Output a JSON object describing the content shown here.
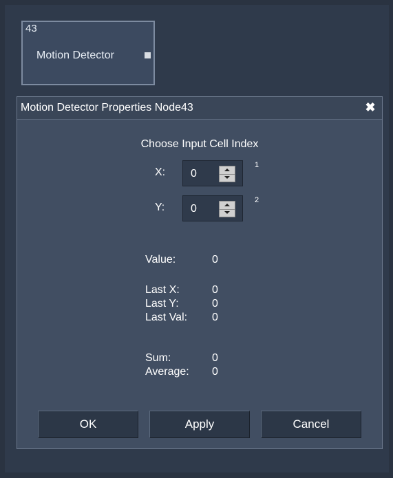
{
  "node": {
    "id": "43",
    "label": "Motion Detector"
  },
  "dialog": {
    "title": "Motion Detector Properties Node43",
    "close_glyph": "✖",
    "heading": "Choose Input Cell Index",
    "spinners": [
      {
        "label": "X:",
        "value": "0",
        "superscript": "1"
      },
      {
        "label": "Y:",
        "value": "0",
        "superscript": "2"
      }
    ],
    "value": {
      "label": "Value:",
      "value": "0"
    },
    "last": [
      {
        "label": "Last X:",
        "value": "0"
      },
      {
        "label": "Last Y:",
        "value": "0"
      },
      {
        "label": "Last Val:",
        "value": "0"
      }
    ],
    "stats": [
      {
        "label": "Sum:",
        "value": "0"
      },
      {
        "label": "Average:",
        "value": "0"
      }
    ],
    "buttons": {
      "ok": "OK",
      "apply": "Apply",
      "cancel": "Cancel"
    }
  }
}
